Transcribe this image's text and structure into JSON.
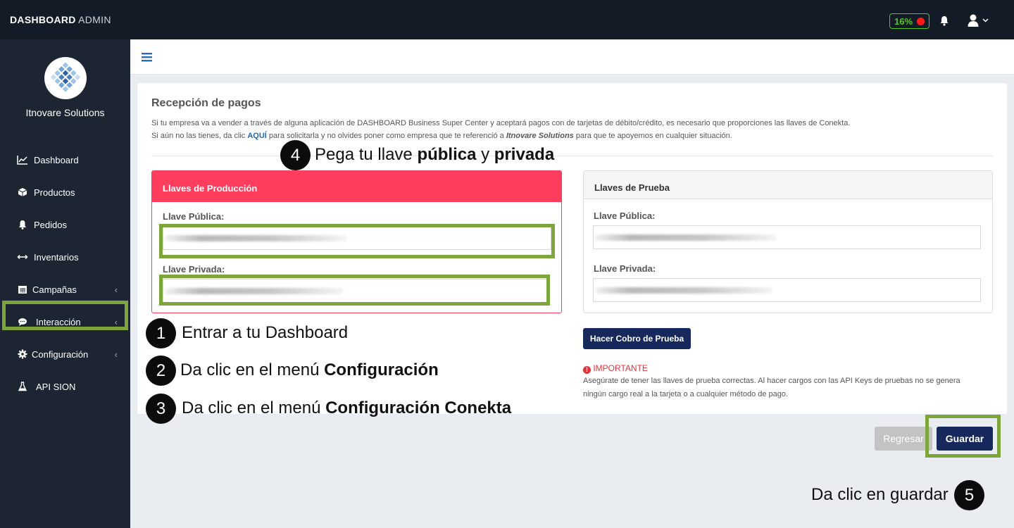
{
  "topbar": {
    "brand_bold": "DASHBOARD",
    "brand_light": "ADMIN",
    "battery": "16%"
  },
  "sidebar": {
    "company": "Itnovare Solutions",
    "items": [
      {
        "label": "Dashboard",
        "icon": "chart-line-icon"
      },
      {
        "label": "Productos",
        "icon": "box-icon"
      },
      {
        "label": "Pedidos",
        "icon": "bell-icon"
      },
      {
        "label": "Inventarios",
        "icon": "arrows-horizontal-icon"
      },
      {
        "label": "Campañas",
        "icon": "calendar-icon",
        "chevron": "‹"
      },
      {
        "label": "Interacción",
        "icon": "comment-icon",
        "chevron": "‹"
      },
      {
        "label": "Configuración",
        "icon": "gear-icon",
        "chevron": "‹"
      },
      {
        "label": "API SION",
        "icon": "flask-icon"
      }
    ]
  },
  "page": {
    "title": "Recepción de pagos",
    "desc1": "Si tu empresa va a vender a través de alguna aplicación de DASHBOARD Business Super Center y aceptará pagos con de tarjetas de débito/crédito, es necesario que proporciones las llaves de Conekta.",
    "desc2_a": "Si aún no las tienes, da clic ",
    "desc2_link": "AQUÍ",
    "desc2_b": " para solicitarla y no olvides poner como empresa que te referenció a ",
    "desc2_company": "Itnovare Solutions",
    "desc2_c": " para que te apoyemos en cualquier situación."
  },
  "production": {
    "title": "Llaves de Producción",
    "public_label": "Llave Pública:",
    "private_label": "Llave Privada:"
  },
  "test": {
    "title": "Llaves de Prueba",
    "public_label": "Llave Pública:",
    "private_label": "Llave Privada:",
    "button": "Hacer Cobro de Prueba",
    "important_title": "IMPORTANTE",
    "important_line1": "Asegúrate de tener las llaves de prueba correctas. Al hacer cargos con las API Keys de pruebas no se genera",
    "important_line2": "ningún cargo real a la tarjeta o a cualquier método de pago."
  },
  "actions": {
    "back": "Regresar",
    "save": "Guardar"
  },
  "steps": [
    {
      "num": "1",
      "text": "Entrar a tu Dashboard",
      "bold": ""
    },
    {
      "num": "2",
      "text": "Da clic en el menú ",
      "bold": "Configuración"
    },
    {
      "num": "3",
      "text": "Da clic en el menú ",
      "bold": "Configuración Conekta"
    },
    {
      "num": "4",
      "text_a": "Pega tu llave ",
      "bold_a": "pública",
      "text_b": " y ",
      "bold_b": "privada"
    },
    {
      "num": "5",
      "text": "Da clic en guardar"
    }
  ],
  "colors": {
    "topbar": "#131b26",
    "sidebar": "#1d2533",
    "production_red": "#ff3d5c",
    "navy_button": "#17285c",
    "highlight_green": "#7ca53b",
    "battery_green": "#58c322"
  }
}
